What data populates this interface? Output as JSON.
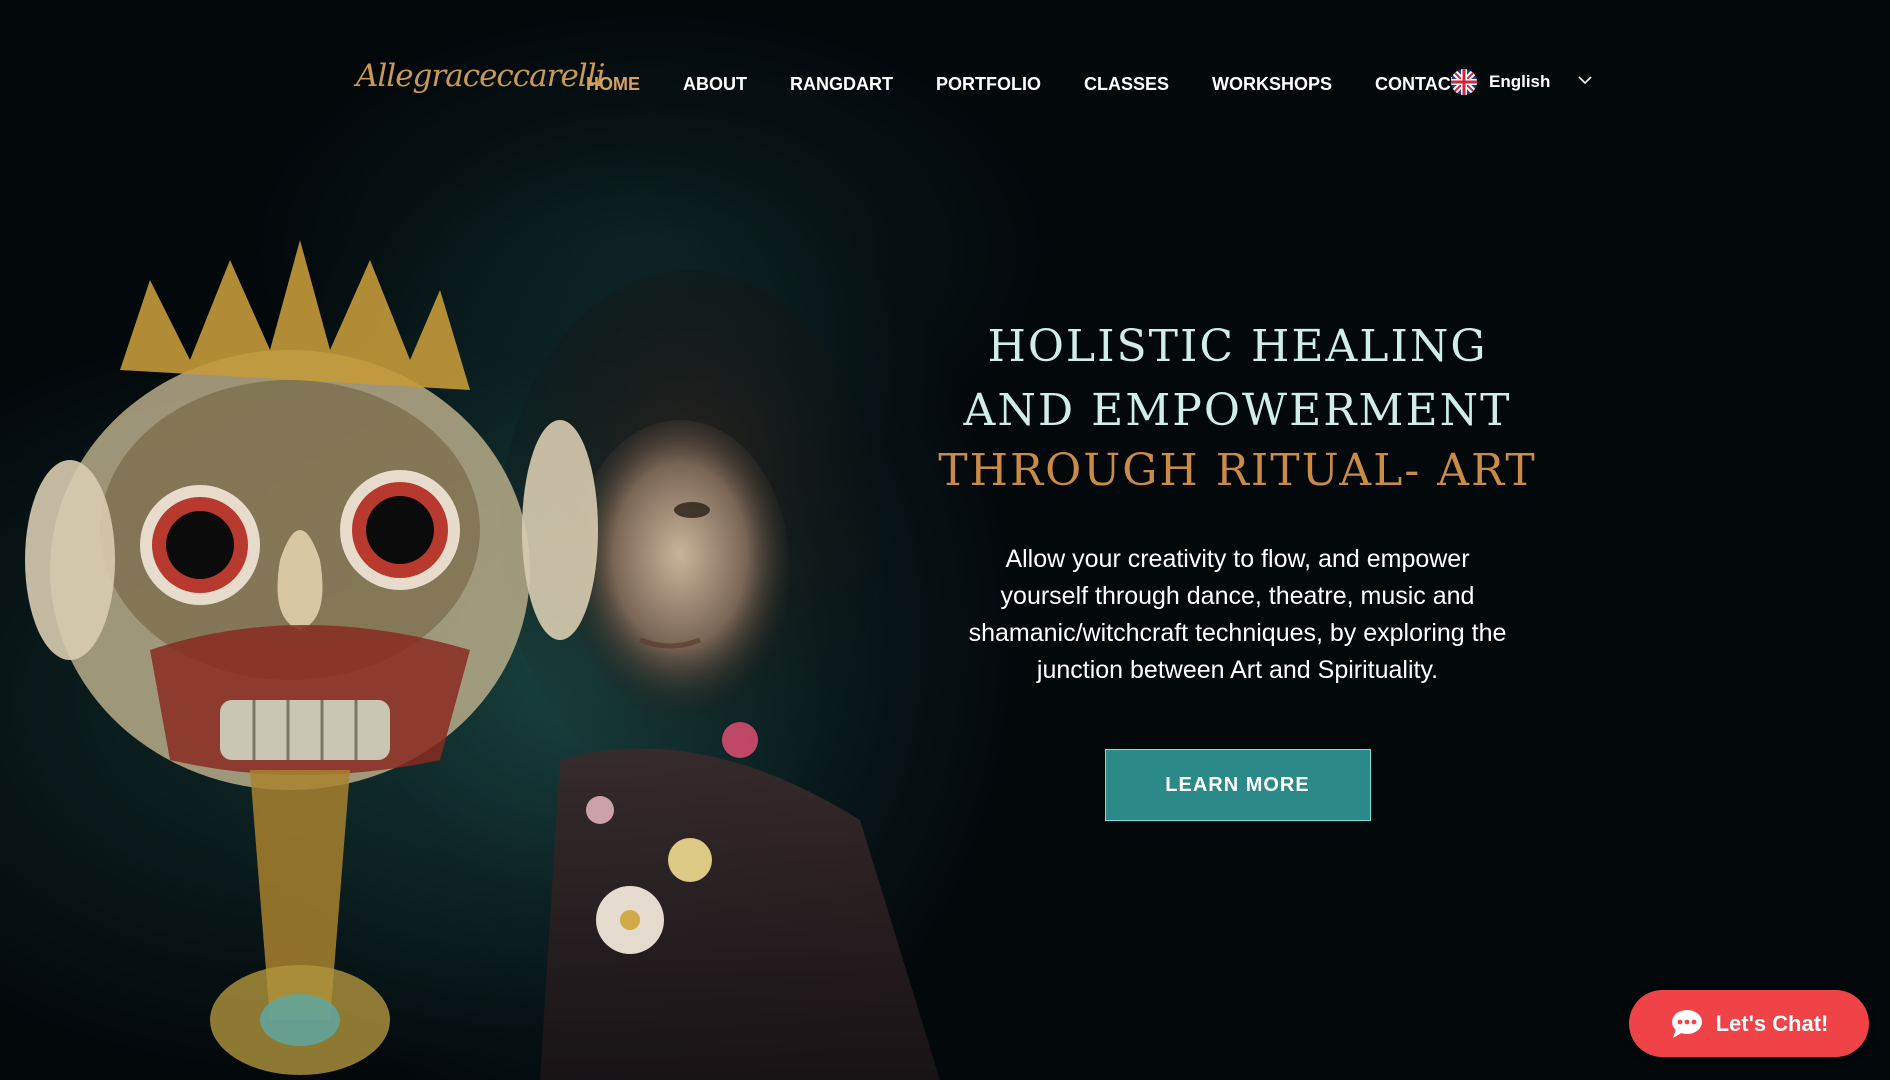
{
  "brand": {
    "logo_text": "Allegraceccarelli"
  },
  "nav": {
    "items": [
      {
        "label": "HOME",
        "active": true
      },
      {
        "label": "ABOUT"
      },
      {
        "label": "RANGDART"
      },
      {
        "label": "PORTFOLIO"
      },
      {
        "label": "CLASSES"
      },
      {
        "label": "WORKSHOPS"
      },
      {
        "label": "CONTACT"
      }
    ],
    "language": {
      "label": "English",
      "flag_icon": "uk-flag-icon",
      "dropdown_icon": "chevron-down-icon"
    }
  },
  "hero": {
    "headline": {
      "line1": "HOLISTIC HEALING",
      "line2": "AND EMPOWERMENT",
      "line3": "THROUGH RITUAL- ART"
    },
    "subtext": "Allow your creativity to flow, and empower yourself through dance, theatre, music and shamanic/witchcraft techniques, by exploring the junction between Art and Spirituality.",
    "cta_label": "LEARN MORE"
  },
  "chat": {
    "label": "Let's Chat!",
    "icon": "chat-bubble-icon"
  },
  "colors": {
    "background": "#03080b",
    "accent_gold": "#c98b45",
    "headline_light": "#cfeeea",
    "cta_teal": "#2b8a88",
    "chat_red": "#f04348"
  }
}
